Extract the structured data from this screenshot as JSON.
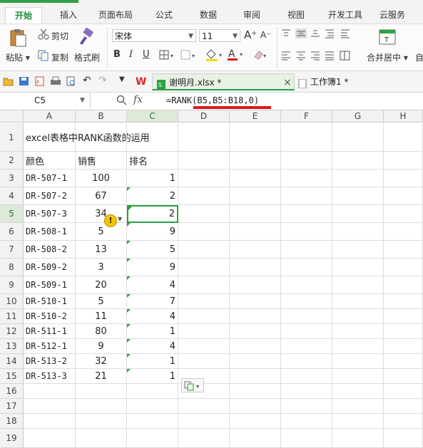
{
  "tabs": [
    "开始",
    "插入",
    "页面布局",
    "公式",
    "数据",
    "审阅",
    "视图",
    "开发工具",
    "云服务"
  ],
  "ribbon": {
    "paste": "粘贴",
    "cut": "剪切",
    "copy": "复制",
    "format_painter": "格式刷",
    "font_name": "宋体",
    "font_size": "11",
    "merge_center": "合并居中",
    "auto_wrap": "自",
    "bold": "B",
    "italic": "I",
    "underline": "U",
    "font_color_letter": "A",
    "grow_font": "A⁺",
    "shrink_font": "A⁻"
  },
  "doc_tabs": [
    {
      "label": "谢明月.xlsx *",
      "close": "×"
    },
    {
      "label": "工作簿1 *"
    }
  ],
  "formula_bar": {
    "cell_ref": "C5",
    "fx": "fx",
    "formula": "=RANK(B5,B5:B18,0)"
  },
  "columns": [
    "A",
    "B",
    "C",
    "D",
    "E",
    "F",
    "G",
    "H"
  ],
  "rows": [
    {
      "n": "1",
      "a": "excel表格中RANK函数的运用",
      "b": "",
      "c": ""
    },
    {
      "n": "2",
      "a": "颜色",
      "b": "销售",
      "c": "排名"
    },
    {
      "n": "3",
      "a": "DR-507-1",
      "b": "100",
      "c": "1"
    },
    {
      "n": "4",
      "a": "DR-507-2",
      "b": "67",
      "c": "2"
    },
    {
      "n": "5",
      "a": "DR-507-3",
      "b": "34",
      "c": "2"
    },
    {
      "n": "6",
      "a": "DR-508-1",
      "b": "5",
      "c": "9"
    },
    {
      "n": "7",
      "a": "DR-508-2",
      "b": "13",
      "c": "5"
    },
    {
      "n": "8",
      "a": "DR-509-2",
      "b": "3",
      "c": "9"
    },
    {
      "n": "9",
      "a": "DR-509-1",
      "b": "20",
      "c": "4"
    },
    {
      "n": "10",
      "a": "DR-510-1",
      "b": "5",
      "c": "7"
    },
    {
      "n": "11",
      "a": "DR-510-2",
      "b": "11",
      "c": "4"
    },
    {
      "n": "12",
      "a": "DR-511-1",
      "b": "80",
      "c": "1"
    },
    {
      "n": "13",
      "a": "DR-512-1",
      "b": "9",
      "c": "4"
    },
    {
      "n": "14",
      "a": "DR-513-2",
      "b": "32",
      "c": "1"
    },
    {
      "n": "15",
      "a": "DR-513-3",
      "b": "21",
      "c": "1"
    },
    {
      "n": "16",
      "a": "",
      "b": "",
      "c": ""
    },
    {
      "n": "17",
      "a": "",
      "b": "",
      "c": ""
    },
    {
      "n": "18",
      "a": "",
      "b": "",
      "c": ""
    },
    {
      "n": "19",
      "a": "",
      "b": "",
      "c": ""
    }
  ],
  "colors": {
    "accent": "#2ea043",
    "underline_red": "#e0161b",
    "warning": "#f5c400"
  },
  "icons": [
    "paste-icon",
    "cut-icon",
    "copy-icon",
    "format-painter-icon",
    "warning-icon",
    "fill-color-icon",
    "font-color-icon",
    "wps-logo-icon",
    "file-icon"
  ]
}
